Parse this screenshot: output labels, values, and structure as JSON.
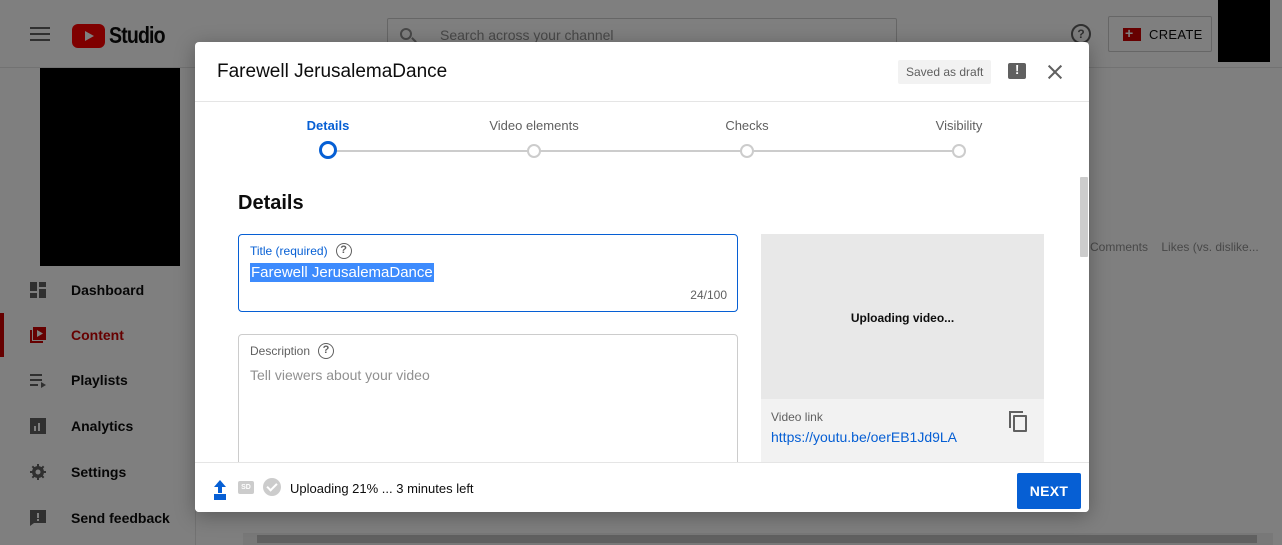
{
  "app": {
    "logo_text": "Studio",
    "search_placeholder": "Search across your channel",
    "help_glyph": "?",
    "create_label": "CREATE"
  },
  "sidebar": {
    "items": [
      {
        "label": "Dashboard",
        "icon": "dashboard-icon"
      },
      {
        "label": "Content",
        "icon": "content-icon",
        "active": true
      },
      {
        "label": "Playlists",
        "icon": "playlists-icon"
      },
      {
        "label": "Analytics",
        "icon": "analytics-icon"
      },
      {
        "label": "Settings",
        "icon": "settings-icon"
      },
      {
        "label": "Send feedback",
        "icon": "feedback-icon"
      }
    ]
  },
  "background": {
    "column_headers": "Comments    Likes (vs. dislike..."
  },
  "dialog": {
    "title": "Farewell JerusalemaDance",
    "saved_badge": "Saved as draft",
    "steps": [
      {
        "label": "Details",
        "active": true
      },
      {
        "label": "Video elements"
      },
      {
        "label": "Checks"
      },
      {
        "label": "Visibility"
      }
    ],
    "section_title": "Details",
    "title_field": {
      "label": "Title (required)",
      "value": "Farewell JerusalemaDance",
      "char_count": "24/100"
    },
    "description_field": {
      "label": "Description",
      "placeholder": "Tell viewers about your video"
    },
    "preview": {
      "status": "Uploading video...",
      "link_label": "Video link",
      "link_value": "https://youtu.be/oerEB1Jd9LA"
    },
    "footer": {
      "sd_badge": "SD",
      "upload_status": "Uploading 21% ... 3 minutes left",
      "upload_progress": 0.21,
      "next_label": "NEXT"
    }
  },
  "colors": {
    "brand_red": "#ff0000",
    "accent_blue": "#065fd4",
    "active_red": "#cc0000"
  }
}
